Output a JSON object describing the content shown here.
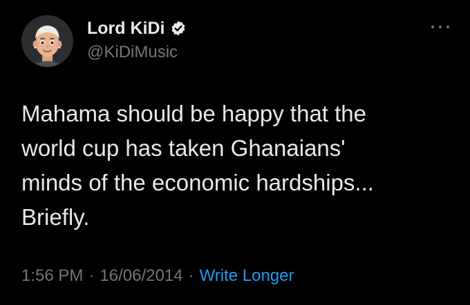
{
  "tweet": {
    "display_name": "Lord KiDi",
    "handle": "@KiDiMusic",
    "text": "Mahama should be happy that the\nworld cup has taken Ghanaians'\nminds of the economic hardships...\nBriefly.",
    "time": "1:56 PM",
    "date": "16/06/2014",
    "separator": "·",
    "source": "Write Longer"
  },
  "colors": {
    "background": "#000000",
    "text": "#e7e9ea",
    "muted": "#71767b",
    "link": "#1d9bf0",
    "verified_badge": "#e7e9ea"
  },
  "icons": {
    "verified": "verified-badge-icon",
    "more": "more-options-icon"
  }
}
